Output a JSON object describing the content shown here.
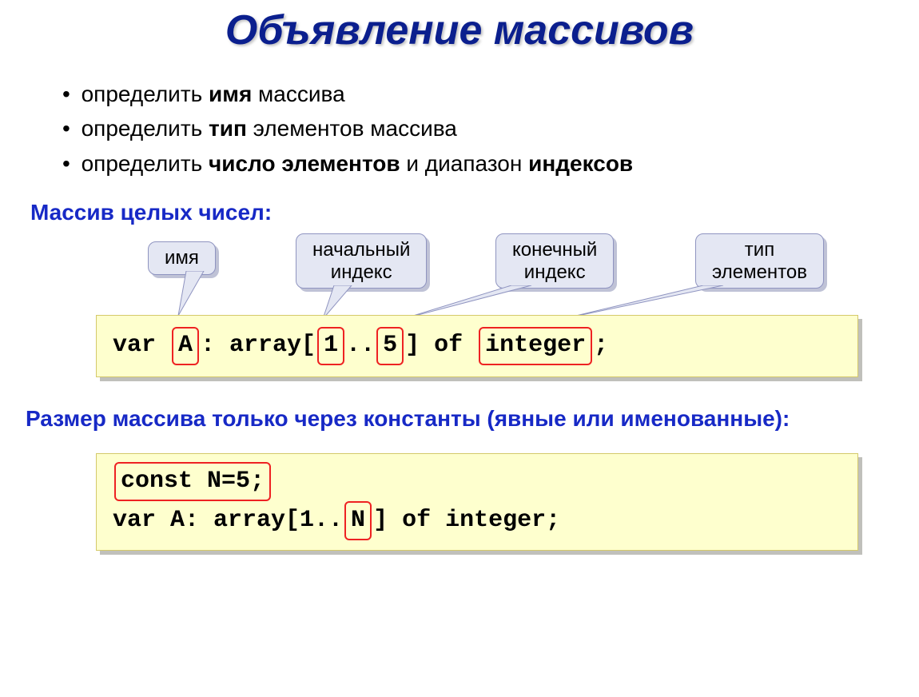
{
  "title": "Объявление массивов",
  "bullets": {
    "b1a": "определить ",
    "b1b": "имя",
    "b1c": " массива",
    "b2a": "определить ",
    "b2b": "тип",
    "b2c": " элементов массива",
    "b3a": "определить ",
    "b3b": "число элементов",
    "b3c": " и диапазон ",
    "b3d": "индексов"
  },
  "sub1": "Массив целых чисел:",
  "callouts": {
    "name": "имя",
    "start": "начальный индекс",
    "end": "конечный индекс",
    "type": "тип элементов"
  },
  "code1": {
    "p1": "var ",
    "A": "A",
    "p2": ": array[",
    "one": "1",
    "p3": "..",
    "five": "5",
    "p4": "] of ",
    "int": "integer",
    "p5": ";"
  },
  "sub2": "Размер массива только через константы (явные или именованные):",
  "code2": {
    "const": "const N=5;",
    "p1": "var A: array[1..",
    "N": "N",
    "p2": "] of integer;"
  }
}
